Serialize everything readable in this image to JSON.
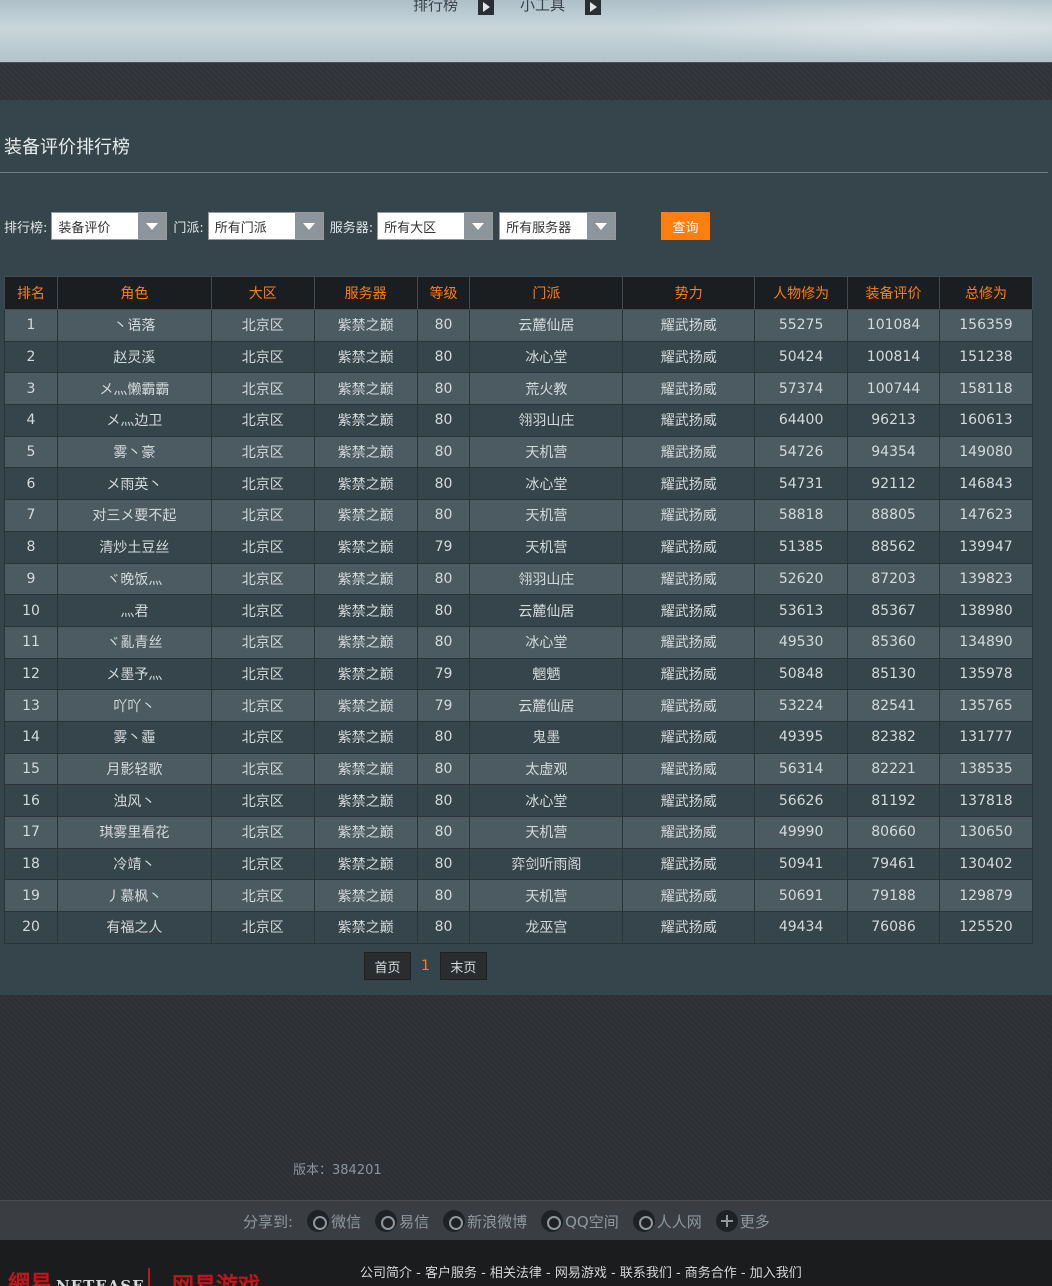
{
  "topnav": {
    "items": [
      {
        "label": "排行榜"
      },
      {
        "label": "小工具"
      }
    ]
  },
  "panel": {
    "title": "装备评价排行榜"
  },
  "filters": {
    "rank_label": "排行榜:",
    "rank_value": "装备评价",
    "sect_label": "门派:",
    "sect_value": "所有门派",
    "server_label": "服务器:",
    "region_value": "所有大区",
    "server_value": "所有服务器",
    "query_label": "查询"
  },
  "table": {
    "headers": [
      "排名",
      "角色",
      "大区",
      "服务器",
      "等级",
      "门派",
      "势力",
      "人物修为",
      "装备评价",
      "总修为"
    ],
    "rows": [
      [
        "1",
        "丶语落",
        "北京区",
        "紫禁之巅",
        "80",
        "云麓仙居",
        "耀武扬威",
        "55275",
        "101084",
        "156359"
      ],
      [
        "2",
        "赵灵溪",
        "北京区",
        "紫禁之巅",
        "80",
        "冰心堂",
        "耀武扬威",
        "50424",
        "100814",
        "151238"
      ],
      [
        "3",
        "メ灬懒霸霸",
        "北京区",
        "紫禁之巅",
        "80",
        "荒火教",
        "耀武扬威",
        "57374",
        "100744",
        "158118"
      ],
      [
        "4",
        "メ灬边卫",
        "北京区",
        "紫禁之巅",
        "80",
        "翎羽山庄",
        "耀武扬威",
        "64400",
        "96213",
        "160613"
      ],
      [
        "5",
        "雾丶豪",
        "北京区",
        "紫禁之巅",
        "80",
        "天机营",
        "耀武扬威",
        "54726",
        "94354",
        "149080"
      ],
      [
        "6",
        "メ雨英丶",
        "北京区",
        "紫禁之巅",
        "80",
        "冰心堂",
        "耀武扬威",
        "54731",
        "92112",
        "146843"
      ],
      [
        "7",
        "对三メ要不起",
        "北京区",
        "紫禁之巅",
        "80",
        "天机营",
        "耀武扬威",
        "58818",
        "88805",
        "147623"
      ],
      [
        "8",
        "清炒土豆丝",
        "北京区",
        "紫禁之巅",
        "79",
        "天机营",
        "耀武扬威",
        "51385",
        "88562",
        "139947"
      ],
      [
        "9",
        "ヾ晚饭灬",
        "北京区",
        "紫禁之巅",
        "80",
        "翎羽山庄",
        "耀武扬威",
        "52620",
        "87203",
        "139823"
      ],
      [
        "10",
        "灬君",
        "北京区",
        "紫禁之巅",
        "80",
        "云麓仙居",
        "耀武扬威",
        "53613",
        "85367",
        "138980"
      ],
      [
        "11",
        "ヾ亂青丝",
        "北京区",
        "紫禁之巅",
        "80",
        "冰心堂",
        "耀武扬威",
        "49530",
        "85360",
        "134890"
      ],
      [
        "12",
        "メ墨予灬",
        "北京区",
        "紫禁之巅",
        "79",
        "魍魉",
        "耀武扬威",
        "50848",
        "85130",
        "135978"
      ],
      [
        "13",
        "吖吖丶",
        "北京区",
        "紫禁之巅",
        "79",
        "云麓仙居",
        "耀武扬威",
        "53224",
        "82541",
        "135765"
      ],
      [
        "14",
        "雾丶霾",
        "北京区",
        "紫禁之巅",
        "80",
        "鬼墨",
        "耀武扬威",
        "49395",
        "82382",
        "131777"
      ],
      [
        "15",
        "月影轻歌",
        "北京区",
        "紫禁之巅",
        "80",
        "太虚观",
        "耀武扬威",
        "56314",
        "82221",
        "138535"
      ],
      [
        "16",
        "浊风丶",
        "北京区",
        "紫禁之巅",
        "80",
        "冰心堂",
        "耀武扬威",
        "56626",
        "81192",
        "137818"
      ],
      [
        "17",
        "琪雾里看花",
        "北京区",
        "紫禁之巅",
        "80",
        "天机营",
        "耀武扬威",
        "49990",
        "80660",
        "130650"
      ],
      [
        "18",
        "冷靖丶",
        "北京区",
        "紫禁之巅",
        "80",
        "弈剑听雨阁",
        "耀武扬威",
        "50941",
        "79461",
        "130402"
      ],
      [
        "19",
        "丿慕枫丶",
        "北京区",
        "紫禁之巅",
        "80",
        "天机营",
        "耀武扬威",
        "50691",
        "79188",
        "129879"
      ],
      [
        "20",
        "有福之人",
        "北京区",
        "紫禁之巅",
        "80",
        "龙巫宫",
        "耀武扬威",
        "49434",
        "76086",
        "125520"
      ]
    ]
  },
  "pager": {
    "first": "首页",
    "current": "1",
    "last": "末页"
  },
  "footer": {
    "version": "版本：384201",
    "share_label": "分享到:",
    "share_items": [
      {
        "label": "微信",
        "icon": "wechat-icon"
      },
      {
        "label": "易信",
        "icon": "yixin-icon"
      },
      {
        "label": "新浪微博",
        "icon": "weibo-icon"
      },
      {
        "label": "QQ空间",
        "icon": "qzone-icon"
      },
      {
        "label": "人人网",
        "icon": "renren-icon"
      },
      {
        "label": "更多",
        "icon": "plus-icon"
      }
    ],
    "logo_cn": "網易",
    "logo_en": "NETEASE",
    "logo2": "网易游戏",
    "links": "公司简介 - 客户服务 - 相关法律 - 网易游戏 - 联系我们 - 商务合作 - 加入我们"
  }
}
